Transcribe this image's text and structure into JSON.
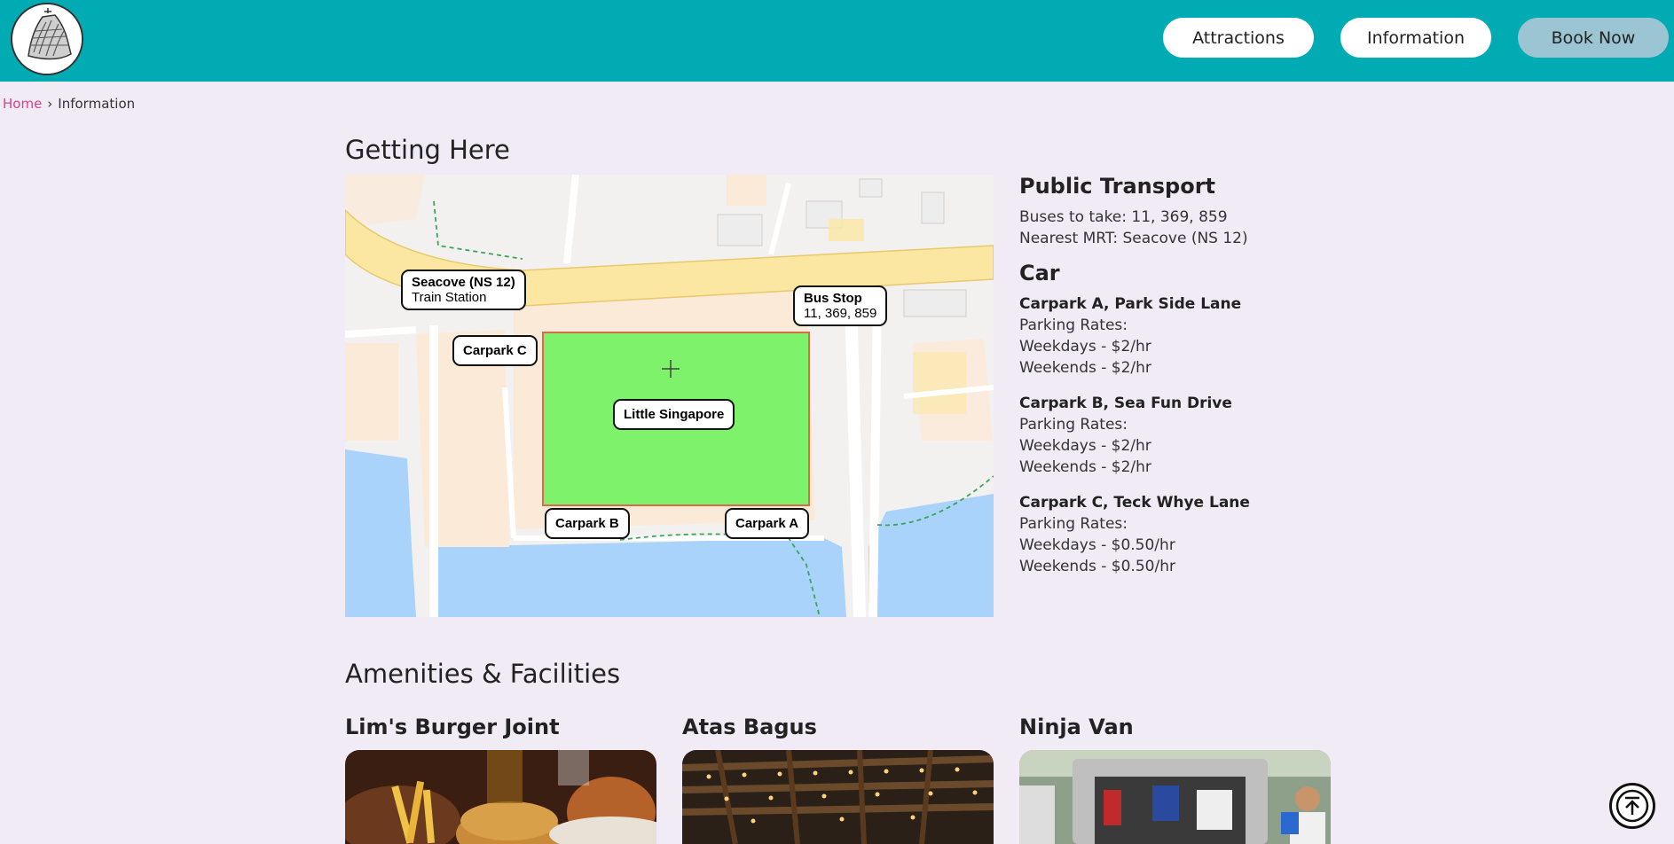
{
  "header": {
    "nav": [
      {
        "label": "Attractions"
      },
      {
        "label": "Information"
      },
      {
        "label": "Book Now"
      }
    ]
  },
  "breadcrumb": {
    "home": "Home",
    "separator": "›",
    "current": "Information"
  },
  "getting_here": {
    "title": "Getting Here",
    "map": {
      "labels": {
        "station_title": "Seacove (NS 12)",
        "station_sub": "Train Station",
        "bus_title": "Bus Stop",
        "bus_sub": "11, 369, 859",
        "carpark_c": "Carpark C",
        "carpark_b": "Carpark B",
        "carpark_a": "Carpark A",
        "center": "Little Singapore"
      }
    },
    "public_transport": {
      "heading": "Public Transport",
      "buses": "Buses to take: 11, 369, 859",
      "mrt": "Nearest MRT: Seacove (NS 12)"
    },
    "car": {
      "heading": "Car",
      "carparks": [
        {
          "name": "Carpark A, Park Side Lane",
          "rates_label": "Parking Rates:",
          "weekdays": "Weekdays - $2/hr",
          "weekends": "Weekends - $2/hr"
        },
        {
          "name": "Carpark B, Sea Fun Drive",
          "rates_label": "Parking Rates:",
          "weekdays": "Weekdays - $2/hr",
          "weekends": "Weekends - $2/hr"
        },
        {
          "name": "Carpark C, Teck Whye Lane",
          "rates_label": "Parking Rates:",
          "weekdays": "Weekdays - $0.50/hr",
          "weekends": "Weekends - $0.50/hr"
        }
      ]
    }
  },
  "amenities": {
    "title": "Amenities & Facilities",
    "items": [
      {
        "name": "Lim's Burger Joint"
      },
      {
        "name": "Atas Bagus"
      },
      {
        "name": "Ninja Van"
      }
    ]
  },
  "icons": {
    "logo": "stadium-logo-icon",
    "scroll_top": "arrow-up-circle-icon"
  },
  "colors": {
    "header": "#00abb3",
    "background": "#f1ebf6",
    "book_now": "#9bc5d3",
    "home_link": "#e0408a",
    "map_highlight": "#7ef26a"
  }
}
